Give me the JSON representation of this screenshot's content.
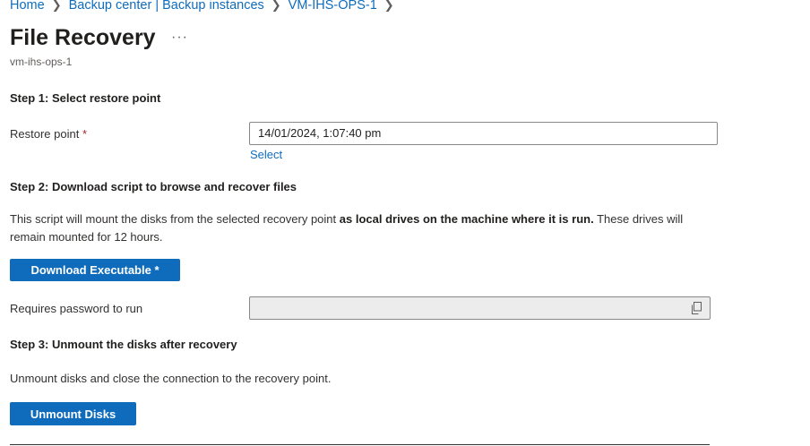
{
  "breadcrumb": [
    {
      "label": "Home"
    },
    {
      "label": "Backup center | Backup instances"
    },
    {
      "label": "VM-IHS-OPS-1"
    }
  ],
  "page": {
    "title": "File Recovery",
    "more": "···",
    "subtitle": "vm-ihs-ops-1"
  },
  "step1": {
    "heading": "Step 1: Select restore point",
    "restore_label": "Restore point",
    "required_mark": "*",
    "restore_value": "14/01/2024, 1:07:40 pm",
    "select_link": "Select"
  },
  "step2": {
    "heading": "Step 2: Download script to browse and recover files",
    "desc_part1": "This script will mount the disks from the selected recovery point ",
    "desc_bold": "as local drives on the machine where it is run.",
    "desc_part2": " These drives will remain mounted for 12 hours.",
    "download_button": "Download Executable *",
    "password_label": "Requires password to run",
    "password_value": "",
    "copy_icon": "copy-icon"
  },
  "step3": {
    "heading": "Step 3: Unmount the disks after recovery",
    "desc": "Unmount disks and close the connection to the recovery point.",
    "unmount_button": "Unmount Disks"
  },
  "colors": {
    "accent": "#0f6cbd",
    "required": "#a4262c",
    "disabled_field": "#ececec"
  }
}
